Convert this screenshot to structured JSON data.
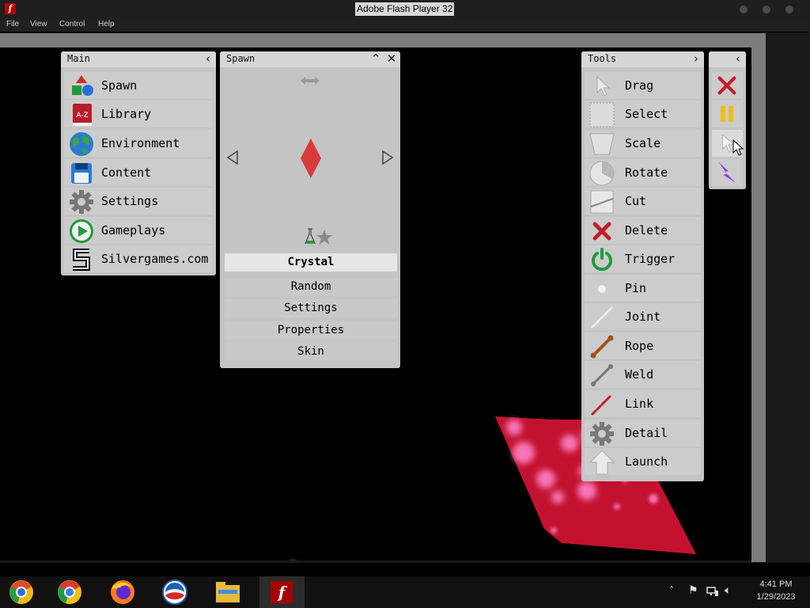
{
  "window": {
    "title": "Adobe Flash Player 32",
    "app_icon": "f"
  },
  "menu": [
    "File",
    "View",
    "Control",
    "Help"
  ],
  "main_panel": {
    "title": "Main",
    "items": [
      {
        "label": "Spawn",
        "icon": "shapes-icon"
      },
      {
        "label": "Library",
        "icon": "book-a-z-icon"
      },
      {
        "label": "Environment",
        "icon": "globe-icon"
      },
      {
        "label": "Content",
        "icon": "floppy-icon"
      },
      {
        "label": "Settings",
        "icon": "gear-icon"
      },
      {
        "label": "Gameplays",
        "icon": "play-icon"
      },
      {
        "label": "Silvergames.com",
        "icon": "silvergames-logo-icon"
      }
    ]
  },
  "spawn_panel": {
    "title": "Spawn",
    "selected": "Crystal",
    "buttons": [
      "Random",
      "Settings",
      "Properties",
      "Skin"
    ]
  },
  "tools_panel": {
    "title": "Tools",
    "items": [
      {
        "label": "Drag",
        "icon": "cursor-icon"
      },
      {
        "label": "Select",
        "icon": "selection-box-icon"
      },
      {
        "label": "Scale",
        "icon": "trapezoid-icon"
      },
      {
        "label": "Rotate",
        "icon": "pie-icon"
      },
      {
        "label": "Cut",
        "icon": "cut-icon"
      },
      {
        "label": "Delete",
        "icon": "red-x-icon"
      },
      {
        "label": "Trigger",
        "icon": "power-icon"
      },
      {
        "label": "Pin",
        "icon": "dot-icon"
      },
      {
        "label": "Joint",
        "icon": "line-icon"
      },
      {
        "label": "Rope",
        "icon": "rope-icon"
      },
      {
        "label": "Weld",
        "icon": "weld-icon"
      },
      {
        "label": "Link",
        "icon": "chain-icon"
      },
      {
        "label": "Detail",
        "icon": "gear-icon"
      },
      {
        "label": "Launch",
        "icon": "up-arrow-icon"
      }
    ]
  },
  "quick_panel": {
    "icons": [
      "clear-x-icon",
      "pause-icon",
      "cursor-icon",
      "lightning-icon"
    ]
  },
  "colors": {
    "crystal": "#d93a3a",
    "shape_fill": "#c3122f",
    "shape_spots": "#ff7fcf",
    "panel": "#c4c4c4"
  },
  "taskbar": {
    "apps": [
      "chrome-canary-icon",
      "chrome-icon",
      "firefox-icon",
      "obama-logo-icon",
      "file-explorer-icon",
      "flash-player-icon"
    ],
    "time": "4:41 PM",
    "date": "1/29/2023"
  }
}
